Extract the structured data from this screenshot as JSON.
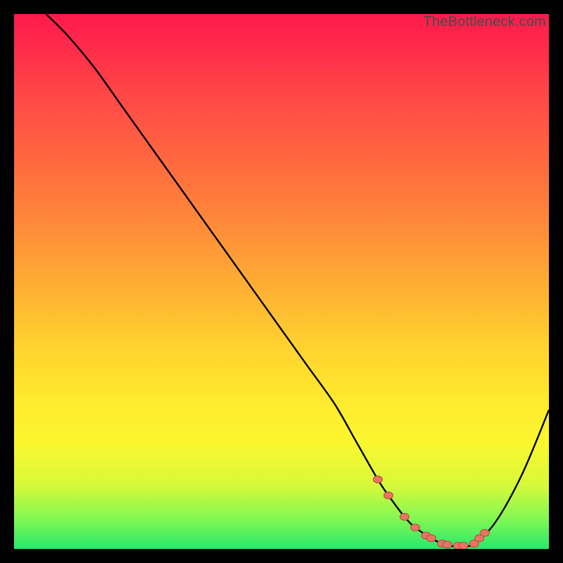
{
  "attribution": "TheBottleneck.com",
  "colors": {
    "frame": "#000000",
    "curve": "#000000",
    "dot_fill": "#e87464",
    "dot_stroke": "#b84a3a"
  },
  "chart_data": {
    "type": "line",
    "title": "",
    "xlabel": "",
    "ylabel": "",
    "xlim": [
      0,
      100
    ],
    "ylim": [
      0,
      100
    ],
    "grid": false,
    "series": [
      {
        "name": "bottleneck-curve",
        "x": [
          6,
          10,
          15,
          20,
          25,
          30,
          35,
          40,
          45,
          50,
          55,
          60,
          64,
          68,
          70,
          73,
          75,
          78,
          80,
          82,
          84,
          86,
          90,
          95,
          100
        ],
        "y": [
          100,
          96,
          90,
          83,
          76,
          69,
          62,
          55,
          48,
          41,
          34,
          27,
          20,
          13,
          10,
          6,
          4,
          2,
          1,
          0.5,
          0.5,
          1,
          5,
          14,
          26
        ]
      }
    ],
    "dots": {
      "name": "highlight-dots",
      "x": [
        68,
        70,
        73,
        75,
        77,
        78,
        80,
        81,
        83,
        84,
        86,
        87,
        88
      ],
      "y": [
        13,
        10,
        6,
        4,
        2.5,
        2,
        1,
        0.8,
        0.6,
        0.6,
        1,
        2,
        3
      ]
    }
  }
}
